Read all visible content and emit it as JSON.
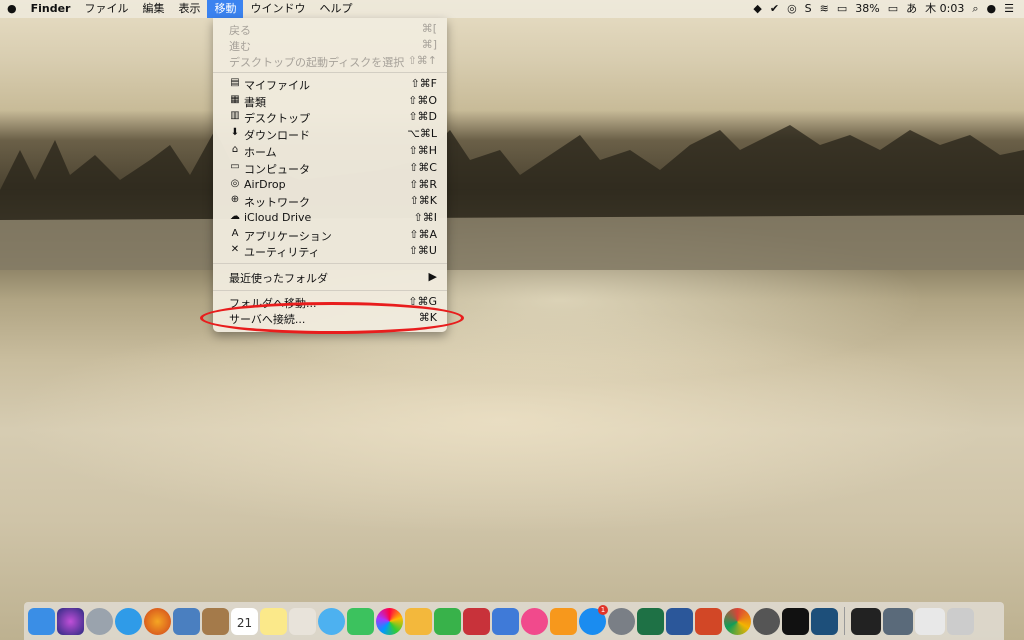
{
  "menubar": {
    "apple": "",
    "app": "Finder",
    "items": [
      "ファイル",
      "編集",
      "表示",
      "移動",
      "ウインドウ",
      "ヘルプ"
    ],
    "battery": "38%",
    "ime": "あ",
    "clock": "木 0:03"
  },
  "go_menu": {
    "back": {
      "label": "戻る",
      "shortcut": "⌘["
    },
    "forward": {
      "label": "進む",
      "shortcut": "⌘]"
    },
    "startup_disk": {
      "label": "デスクトップの起動ディスクを選択",
      "shortcut": "⇧⌘↑"
    },
    "my_files": {
      "label": "マイファイル",
      "shortcut": "⇧⌘F"
    },
    "documents": {
      "label": "書類",
      "shortcut": "⇧⌘O"
    },
    "desktop": {
      "label": "デスクトップ",
      "shortcut": "⇧⌘D"
    },
    "downloads": {
      "label": "ダウンロード",
      "shortcut": "⌥⌘L"
    },
    "home": {
      "label": "ホーム",
      "shortcut": "⇧⌘H"
    },
    "computer": {
      "label": "コンピュータ",
      "shortcut": "⇧⌘C"
    },
    "airdrop": {
      "label": "AirDrop",
      "shortcut": "⇧⌘R"
    },
    "network": {
      "label": "ネットワーク",
      "shortcut": "⇧⌘K"
    },
    "icloud": {
      "label": "iCloud Drive",
      "shortcut": "⇧⌘I"
    },
    "applications": {
      "label": "アプリケーション",
      "shortcut": "⇧⌘A"
    },
    "utilities": {
      "label": "ユーティリティ",
      "shortcut": "⇧⌘U"
    },
    "recent": {
      "label": "最近使ったフォルダ",
      "shortcut": "▶"
    },
    "goto_folder": {
      "label": "フォルダへ移動...",
      "shortcut": "⇧⌘G"
    },
    "connect_server": {
      "label": "サーバへ接続...",
      "shortcut": "⌘K"
    }
  },
  "dock": {
    "calendar_day": "21",
    "appstore_badge": "1"
  },
  "colors": {
    "menu_highlight": "#3b83f0",
    "annotation": "#e81d1d"
  }
}
